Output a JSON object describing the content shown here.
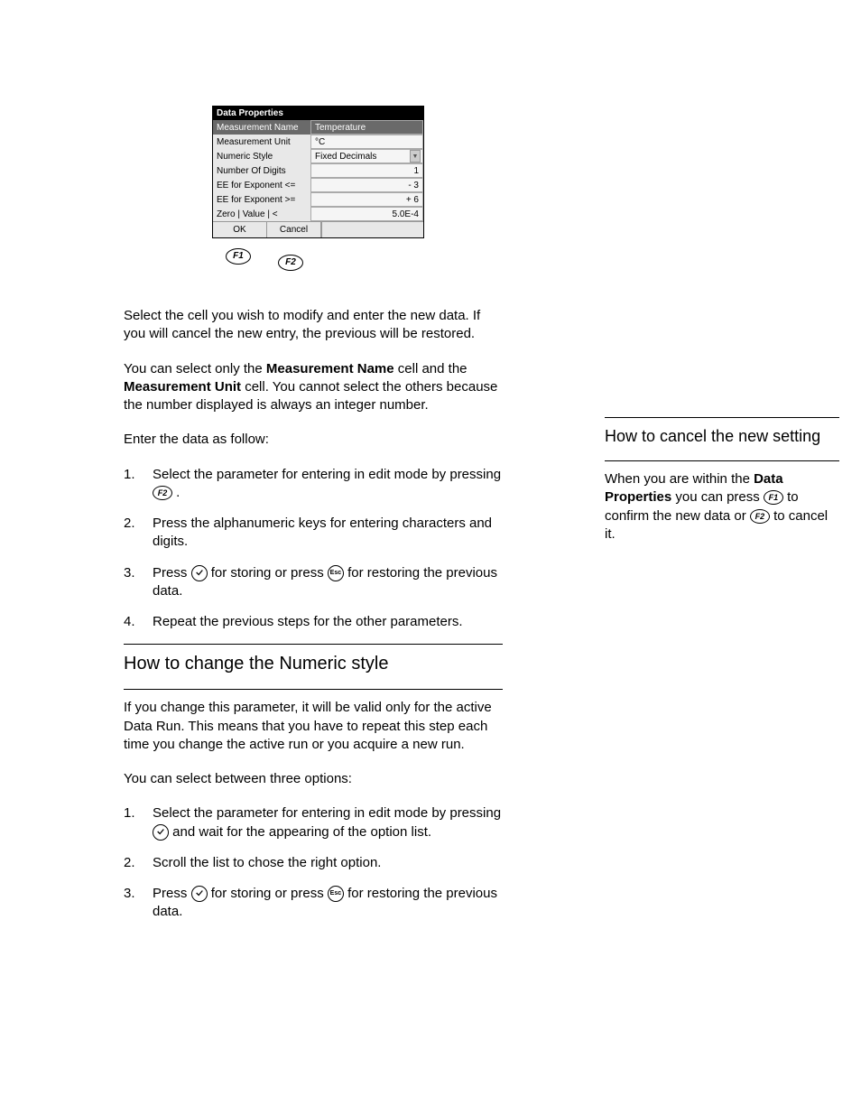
{
  "dialog": {
    "title": "Data Properties",
    "rows": [
      {
        "label": "Measurement Name",
        "value": "Temperature",
        "selected": true
      },
      {
        "label": "Measurement Unit",
        "value": "°C"
      },
      {
        "label": "Numeric Style",
        "value": "Fixed Decimals",
        "dropdown": true
      },
      {
        "label": "Number Of Digits",
        "value": "1",
        "right": true
      },
      {
        "label": "EE for Exponent <=",
        "value": "- 3",
        "right": true
      },
      {
        "label": "EE for Exponent >=",
        "value": "+ 6",
        "right": true
      },
      {
        "label": "Zero | Value |  <",
        "value": "5.0E-4",
        "right": true
      }
    ],
    "ok_label": "OK",
    "cancel_label": "Cancel"
  },
  "fkeys": {
    "f1": "F1",
    "f2": "F2",
    "esc": "Esc"
  },
  "leftcol": {
    "p1": "Select the cell you wish to modify and enter the new data. If you will cancel the new entry, the previous will be restored.",
    "p2a": "You can select only the ",
    "p2b": "Measurement Name",
    "p2c": " cell and the ",
    "p2d": "Measurement Unit",
    "p2e": " cell. You cannot select the others because the number displayed is always an integer number.",
    "s1_h": "Enter the data as follow:",
    "s1_num": "1.",
    "s1a": "Select the parameter for entering in edit mode by pressing ",
    "s1b": ".",
    "s2_num": "2.",
    "s2": "Press the alphanumeric keys for entering characters and digits.",
    "s3_num": "3.",
    "s3a": "Press ",
    "s3b": " for storing or press ",
    "s3c": " for restoring the previous data.",
    "s4_num": "4.",
    "s4": "Repeat the previous steps for the other parameters.",
    "h2": "How to change the Numeric style",
    "p3": "If you change this parameter, it will be valid only for the active Data Run. This means that you have to repeat this step each time you change the active run or you acquire a new run.",
    "p4": "You can select between three options:",
    "s5_num": "1.",
    "s5a": "Select the parameter for entering in edit mode by pressing ",
    "s5b": " and wait for the appearing of the option list.",
    "s6_num": "2.",
    "s6": "Scroll the list to chose the right option.",
    "s7_num": "3.",
    "s7a": "Press ",
    "s7b": " for storing or press ",
    "s7c": " for restoring the previous data."
  },
  "rightcol": {
    "h1": "How to cancel the new setting",
    "p1a": "When you are within the ",
    "p1b": "Data Properties",
    "p1c": " you can press ",
    "p1d": " to confirm the new data or ",
    "p1e": " to cancel it."
  }
}
